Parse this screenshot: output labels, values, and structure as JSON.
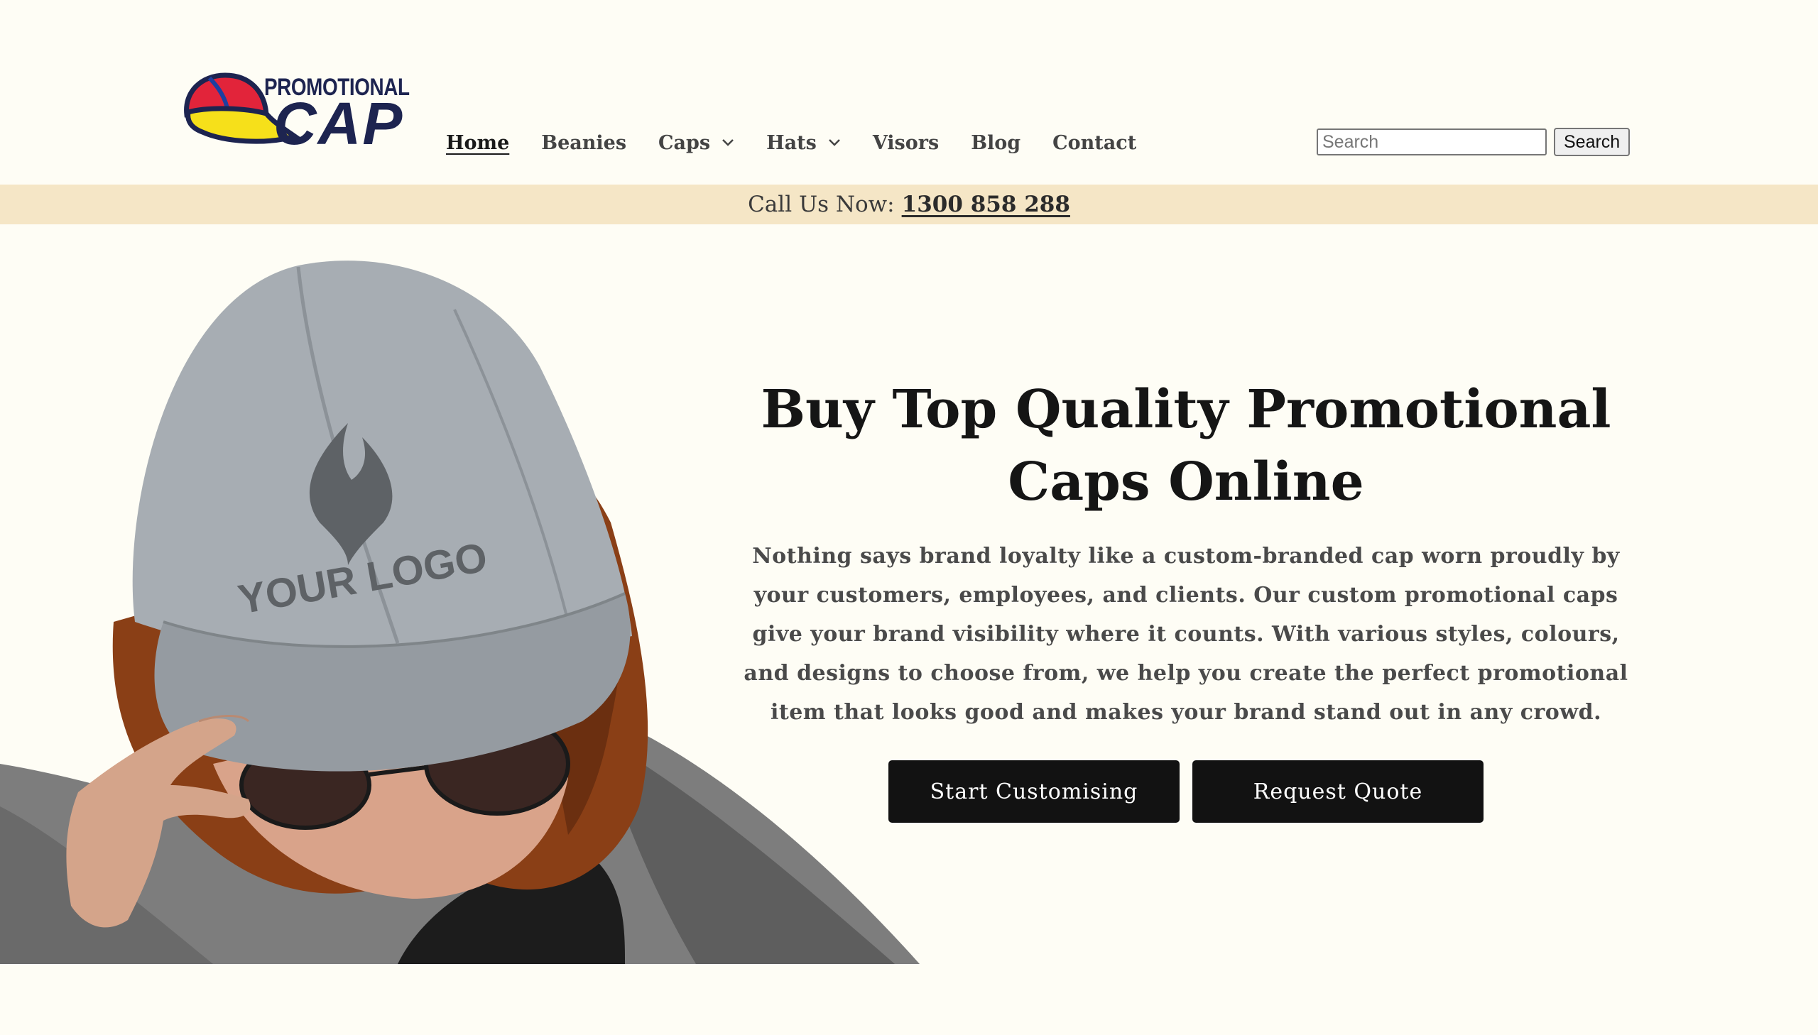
{
  "brand": {
    "logo_top": "PROMOTIONAL",
    "logo_bottom": "CAP",
    "colors": {
      "navy": "#1d2450",
      "red": "#e2243a",
      "yellow": "#f6e01a",
      "blue": "#1d3fa0"
    }
  },
  "nav": {
    "items": [
      {
        "label": "Home",
        "active": true
      },
      {
        "label": "Beanies"
      },
      {
        "label": "Caps",
        "dropdown": true
      },
      {
        "label": "Hats",
        "dropdown": true
      },
      {
        "label": "Visors"
      },
      {
        "label": "Blog"
      },
      {
        "label": "Contact"
      }
    ]
  },
  "search": {
    "placeholder": "Search",
    "value": "",
    "button_label": "Search"
  },
  "announcement": {
    "prefix": "Call Us Now:",
    "phone": "1300 858 288",
    "bg_color": "#f5e6c6"
  },
  "hero": {
    "title": "Buy Top Quality Promotional Caps Online",
    "description": "Nothing says brand loyalty like a custom-branded cap worn proudly by your customers, employees, and clients. Our custom promotional caps give your brand visibility where it counts.  With various styles, colours, and designs to choose from, we help you create the perfect promotional item that looks good and makes your brand stand out in any crowd.",
    "image_cap_text": "YOUR LOGO",
    "buttons": {
      "primary": "Start Customising",
      "secondary": "Request Quote"
    }
  }
}
